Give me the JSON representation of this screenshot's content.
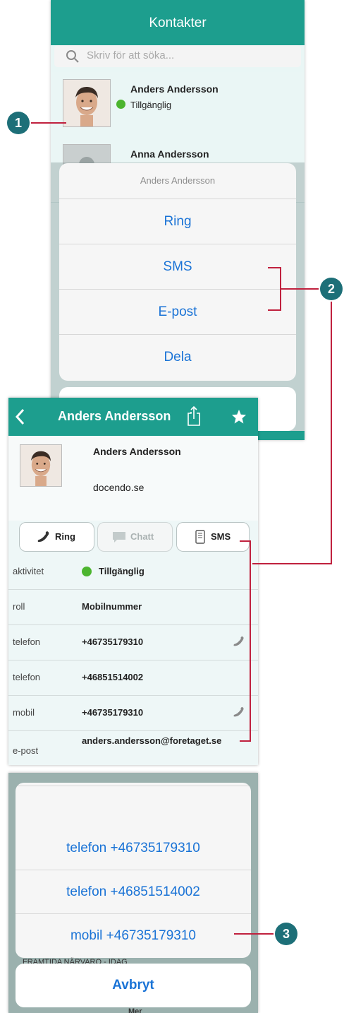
{
  "screen1": {
    "title": "Kontakter",
    "search_placeholder": "Skriv för att söka...",
    "contacts": [
      {
        "name": "Anders Andersson",
        "status": "Tillgänglig",
        "status_color": "#4cb52f"
      },
      {
        "name": "Anna Andersson",
        "status": ""
      }
    ],
    "action_sheet": {
      "title": "Anders Andersson",
      "items": [
        "Ring",
        "SMS",
        "E-post",
        "Dela"
      ]
    }
  },
  "screen2": {
    "title": "Anders Andersson",
    "profile": {
      "name": "Anders Andersson",
      "organization": "docendo.se"
    },
    "buttons": {
      "call": "Ring",
      "chat": "Chatt",
      "sms": "SMS"
    },
    "rows": [
      {
        "label": "aktivitet",
        "value": "Tillgänglig",
        "icon": "status-dot"
      },
      {
        "label": "roll",
        "value": "Mobilnummer"
      },
      {
        "label": "telefon",
        "value": "+46735179310",
        "icon": "phone-icon"
      },
      {
        "label": "telefon",
        "value": "+46851514002"
      },
      {
        "label": "mobil",
        "value": "+46735179310",
        "icon": "phone-icon"
      },
      {
        "label": "e-post",
        "value": "anders.andersson@foretaget.se"
      }
    ]
  },
  "screen3": {
    "options": [
      "telefon +46735179310",
      "telefon +46851514002",
      "mobil +46735179310"
    ],
    "cancel": "Avbryt",
    "background_text": "FRAMTIDA NÄRVARO - IDAG",
    "background_more": "Mer"
  },
  "callouts": [
    "1",
    "2",
    "3"
  ],
  "colors": {
    "accent": "#1d9e8e",
    "link": "#1a73d6",
    "callout": "#1d6f78",
    "leader": "#c0213e"
  }
}
